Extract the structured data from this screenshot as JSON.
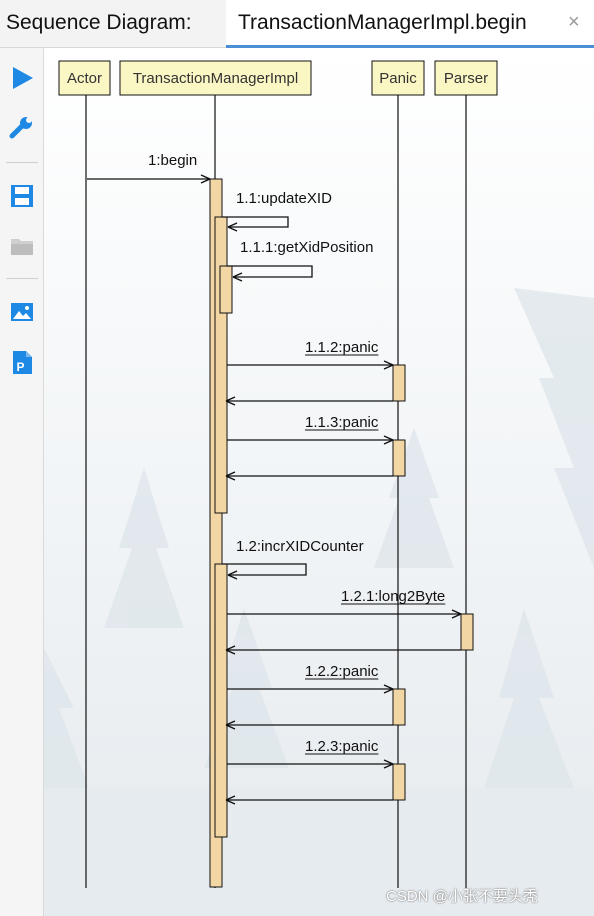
{
  "header": {
    "panel_title": "Sequence Diagram:",
    "tab_label": "TransactionManagerImpl.begin",
    "close_glyph": "×"
  },
  "toolbar": {
    "items": [
      {
        "icon": "play-icon"
      },
      {
        "icon": "wrench-icon"
      },
      {
        "icon": "save-icon"
      },
      {
        "icon": "folder-icon"
      },
      {
        "icon": "image-icon"
      },
      {
        "icon": "pdf-export-icon"
      }
    ],
    "accent": "#1e88e5"
  },
  "diagram": {
    "participants": [
      {
        "id": "actor",
        "label": "Actor"
      },
      {
        "id": "tmi",
        "label": "TransactionManagerImpl"
      },
      {
        "id": "panic",
        "label": "Panic"
      },
      {
        "id": "parser",
        "label": "Parser"
      }
    ],
    "messages": [
      {
        "label": "1:begin",
        "from": "actor",
        "to": "tmi"
      },
      {
        "label": "1.1:updateXID",
        "from": "tmi",
        "to": "tmi"
      },
      {
        "label": "1.1.1:getXidPosition",
        "from": "tmi",
        "to": "tmi"
      },
      {
        "label": "1.1.2:panic",
        "from": "tmi",
        "to": "panic"
      },
      {
        "label": "1.1.3:panic",
        "from": "tmi",
        "to": "panic"
      },
      {
        "label": "1.2:incrXIDCounter",
        "from": "tmi",
        "to": "tmi"
      },
      {
        "label": "1.2.1:long2Byte",
        "from": "tmi",
        "to": "parser"
      },
      {
        "label": "1.2.2:panic",
        "from": "tmi",
        "to": "panic"
      },
      {
        "label": "1.2.3:panic",
        "from": "tmi",
        "to": "panic"
      }
    ],
    "colors": {
      "participant_fill": "#fbf7c4",
      "activation_fill": "#f2d7a5",
      "line": "#111111"
    }
  },
  "watermark": "CSDN @小张不要头秃"
}
